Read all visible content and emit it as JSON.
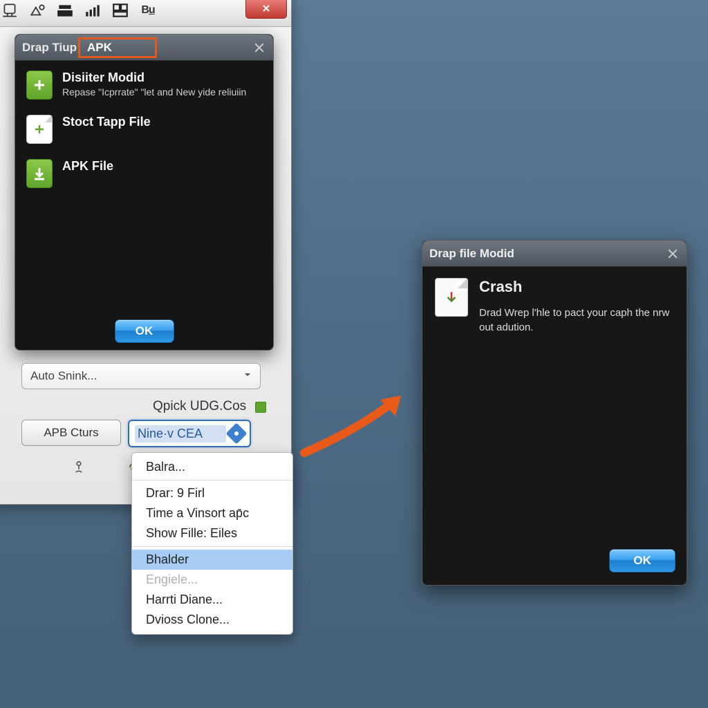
{
  "toolbar": {
    "icons": [
      "device-icon",
      "shapes-icon",
      "stack-icon",
      "signal-icon",
      "layout-icon",
      "text-bold-icon"
    ]
  },
  "modal1": {
    "title_prefix": "Drap Tiup",
    "title_highlight": "APK",
    "items": [
      {
        "title": "Disiiter Modid",
        "sub": "Repase \"Icprrate\" \"let and New yide reliuiin"
      },
      {
        "title": "Stoct Tapp File",
        "sub": ""
      },
      {
        "title": "APK File",
        "sub": ""
      }
    ],
    "ok": "OK"
  },
  "combo": {
    "label": "Auto Snink..."
  },
  "quick_label": "Qpick UDG.Cos",
  "buttons": {
    "apb": "APB Cturs",
    "select_text": "Nine·v    CEA"
  },
  "context_menu": {
    "items": [
      {
        "label": "Balra...",
        "state": "normal"
      },
      {
        "sep": true
      },
      {
        "label": "Drar: 9 Firl",
        "state": "normal"
      },
      {
        "label": "Time a Vinsort ap̄c",
        "state": "normal"
      },
      {
        "label": "Show Fille: Eiles",
        "state": "normal"
      },
      {
        "sep": true
      },
      {
        "label": "Bhalder",
        "state": "selected"
      },
      {
        "label": "Engiele...",
        "state": "disabled"
      },
      {
        "label": "Harrti Diane...",
        "state": "normal"
      },
      {
        "label": "Dvioss Clone...",
        "state": "normal"
      }
    ]
  },
  "modal2": {
    "title": "Drap file Modid",
    "heading": "Crash",
    "body": "Drad Wrep l'hle to pact your caph the nrw out adution.",
    "ok": "OK"
  }
}
